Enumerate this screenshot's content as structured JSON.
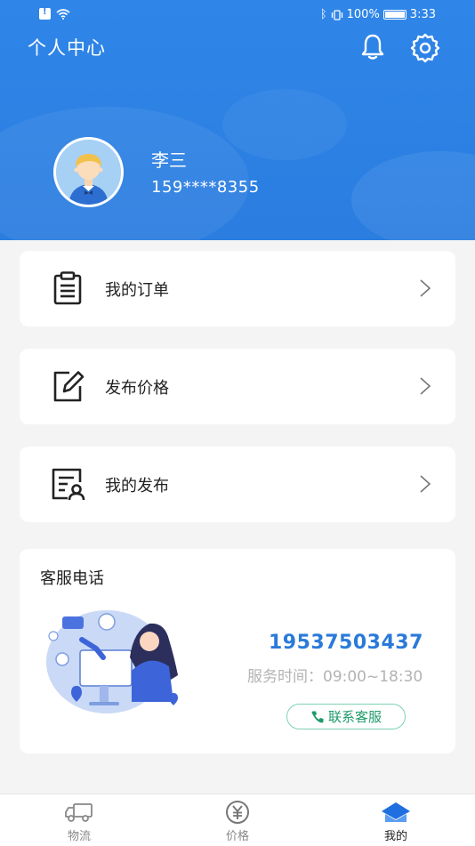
{
  "status_bar": {
    "battery": "100%",
    "time": "3:33"
  },
  "header": {
    "title": "个人中心"
  },
  "user": {
    "name": "李三",
    "phone": "159****8355"
  },
  "menu": [
    {
      "label": "我的订单",
      "icon": "clipboard-icon"
    },
    {
      "label": "发布价格",
      "icon": "edit-icon"
    },
    {
      "label": "我的发布",
      "icon": "user-document-icon"
    }
  ],
  "service": {
    "title": "客服电话",
    "phone": "19537503437",
    "hours": "服务时间：09:00~18:30",
    "contact_label": "联系客服"
  },
  "tabs": [
    {
      "label": "物流",
      "icon": "truck-icon",
      "active": false
    },
    {
      "label": "价格",
      "icon": "yen-icon",
      "active": false
    },
    {
      "label": "我的",
      "icon": "home-icon",
      "active": true
    }
  ],
  "colors": {
    "primary": "#2f86e8",
    "phone_blue": "#2a7ad9",
    "contact_green": "#1e9b6a"
  }
}
